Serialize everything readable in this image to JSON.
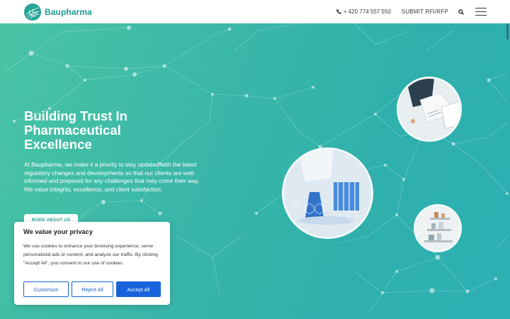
{
  "header": {
    "logo_text": "Baupharma",
    "phone": "+ 420 774 557 550",
    "rfp_label": "SUBMIT RFI/RFP",
    "icons": [
      "phone-icon",
      "search-icon",
      "hamburger-menu-icon"
    ]
  },
  "hero": {
    "headline_lines": [
      "Building Trust In",
      "Pharmaceutical",
      "Excellence"
    ],
    "body": "At Baupharma, we make it a priority to stay updated with the latest regulatory changes and developments so that our clients are well-informed and prepared for any challenges that may come their way. We value integrity, excellence, and client satisfaction.",
    "cta_label": "MORE ABOUT US"
  },
  "cookie": {
    "title": "We value your privacy",
    "text": "We use cookies to enhance your browsing experience, serve personalized ads or content, and analyze our traffic. By clicking \"Accept All\", you consent to our use of cookies.",
    "customize_label": "Customize",
    "reject_label": "Reject All",
    "accept_label": "Accept All"
  },
  "colors": {
    "brand": "#1f9a8d",
    "hero_start": "#49c4a5",
    "hero_end": "#2eb0b4",
    "cookie_accent": "#1863dc"
  }
}
